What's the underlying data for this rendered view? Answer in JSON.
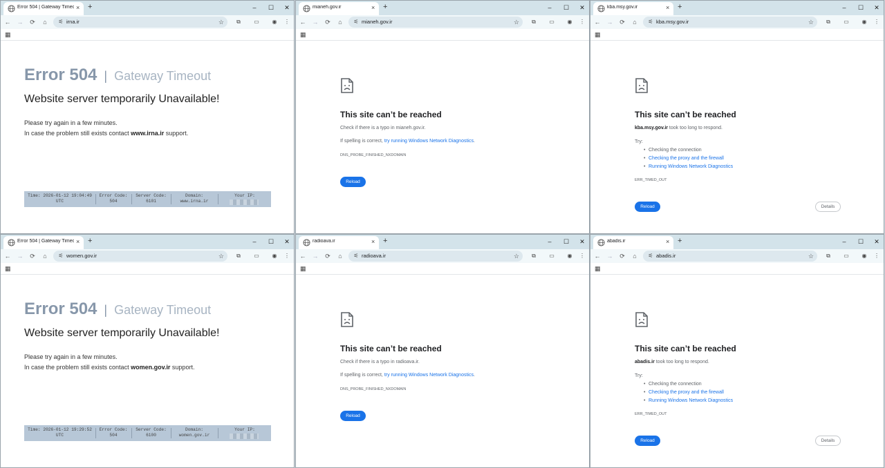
{
  "windows": [
    {
      "type": "err504",
      "tab_title": "Error 504 | Gateway Timeout",
      "url": "irna.ir",
      "error_code": "Error 504",
      "separator": "|",
      "error_subtitle": "Gateway Timeout",
      "headline": "Website server temporarily Unavailable!",
      "line1": "Please try again in a few minutes.",
      "line2_prefix": "In case the problem still exists contact ",
      "line2_domain": "www.irna.ir",
      "line2_suffix": " support.",
      "info": {
        "time_label": "Time: 2026-01-12 19:04:49",
        "time_tz": "UTC",
        "code_label": "Error Code:",
        "code_value": "504",
        "server_label": "Server Code:",
        "server_value": "6101",
        "domain_label": "Domain:",
        "domain_value": "www.irna.ir",
        "ip_label": "Your IP:"
      }
    },
    {
      "type": "unreachable",
      "tab_title": "mianeh.gov.ir",
      "url": "mianeh.gov.ir",
      "title": "This site can’t be reached",
      "line1": "Check if there is a typo in mianeh.gov.ir.",
      "line2_prefix": "If spelling is correct, ",
      "line2_link": "try running Windows Network Diagnostics",
      "line2_suffix": ".",
      "code": "DNS_PROBE_FINISHED_NXDOMAIN",
      "reload_label": "Reload"
    },
    {
      "type": "timeout",
      "tab_title": "kba.msy.gov.ir",
      "url": "kba.msy.gov.ir",
      "title": "This site can’t be reached",
      "host": "kba.msy.gov.ir",
      "line1_suffix": " took too long to respond.",
      "try_label": "Try:",
      "try_items": [
        {
          "text": "Checking the connection"
        },
        {
          "text": "Checking the proxy and the firewall"
        },
        {
          "text": "Running Windows Network Diagnostics"
        }
      ],
      "code": "ERR_TIMED_OUT",
      "reload_label": "Reload",
      "details_label": "Details"
    },
    {
      "type": "err504",
      "tab_title": "Error 504 | Gateway Timeout",
      "url": "women.gov.ir",
      "error_code": "Error 504",
      "separator": "|",
      "error_subtitle": "Gateway Timeout",
      "headline": "Website server temporarily Unavailable!",
      "line1": "Please try again in a few minutes.",
      "line2_prefix": "In case the problem still exists contact ",
      "line2_domain": "women.gov.ir",
      "line2_suffix": " support.",
      "info": {
        "time_label": "Time: 2026-01-12 19:29:52",
        "time_tz": "UTC",
        "code_label": "Error Code:",
        "code_value": "504",
        "server_label": "Server Code:",
        "server_value": "6100",
        "domain_label": "Domain:",
        "domain_value": "women.gov.ir",
        "ip_label": "Your IP:"
      }
    },
    {
      "type": "unreachable",
      "tab_title": "radioava.ir",
      "url": "radioava.ir",
      "title": "This site can’t be reached",
      "line1": "Check if there is a typo in radioava.ir.",
      "line2_prefix": "If spelling is correct, ",
      "line2_link": "try running Windows Network Diagnostics",
      "line2_suffix": ".",
      "code": "DNS_PROBE_FINISHED_NXDOMAIN",
      "reload_label": "Reload"
    },
    {
      "type": "timeout",
      "tab_title": "abadis.ir",
      "url": "abadis.ir",
      "title": "This site can’t be reached",
      "host": "abadis.ir",
      "line1_suffix": " took too long to respond.",
      "try_label": "Try:",
      "try_items": [
        {
          "text": "Checking the connection"
        },
        {
          "text": "Checking the proxy and the firewall"
        },
        {
          "text": "Running Windows Network Diagnostics"
        }
      ],
      "code": "ERR_TIMED_OUT",
      "reload_label": "Reload",
      "details_label": "Details"
    }
  ],
  "icons": {
    "tab_close": "×",
    "new_tab": "+",
    "minimize": "–",
    "maximize": "☐",
    "close": "✕",
    "back": "←",
    "forward": "→",
    "reload": "⟳",
    "home": "⌂",
    "star": "☆",
    "extensions": "⧉",
    "media": "▭",
    "profile": "◉",
    "menu": "⋮",
    "apps": "▦",
    "site_info": "ⓘ",
    "tune": "⚟"
  }
}
